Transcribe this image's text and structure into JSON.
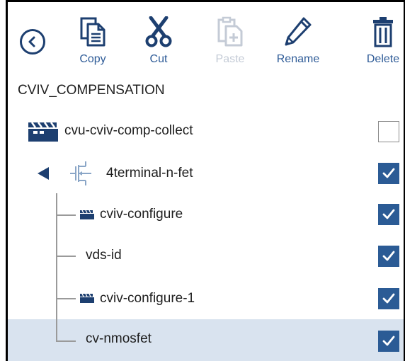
{
  "toolbar": {
    "copy_label": "Copy",
    "cut_label": "Cut",
    "paste_label": "Paste",
    "rename_label": "Rename",
    "delete_label": "Delete"
  },
  "section_title": "CVIV_COMPENSATION",
  "tree": {
    "root": {
      "label": "cvu-cviv-comp-collect",
      "icon": "clapperboard-icon",
      "checked": false
    },
    "device": {
      "label": "4terminal-n-fet",
      "icon": "transistor-icon",
      "expanded": true,
      "checked": true
    },
    "children": [
      {
        "label": "cviv-configure",
        "icon": "clapperboard-icon",
        "checked": true
      },
      {
        "label": "vds-id",
        "icon": "",
        "checked": true
      },
      {
        "label": "cviv-configure-1",
        "icon": "clapperboard-icon",
        "checked": true
      },
      {
        "label": "cv-nmosfet",
        "icon": "",
        "checked": true,
        "selected": true
      }
    ]
  },
  "colors": {
    "accent": "#2e5b97",
    "checkbox_checked": "#2b5b95",
    "selected_row": "#d9e3ef",
    "disabled_label": "#c4cbd6"
  }
}
